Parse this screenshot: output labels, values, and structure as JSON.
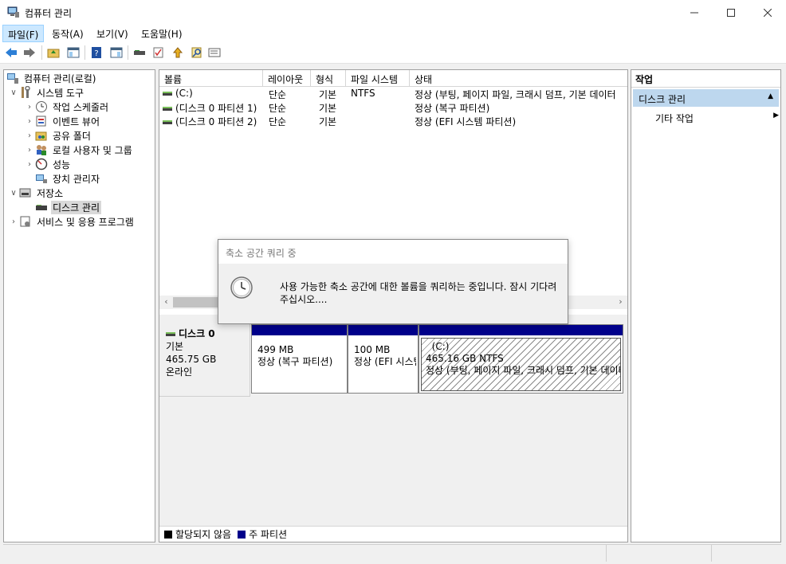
{
  "window": {
    "title": "컴퓨터 관리"
  },
  "menu": [
    "파일(F)",
    "동작(A)",
    "보기(V)",
    "도움말(H)"
  ],
  "tree": {
    "root": "컴퓨터 관리(로컬)",
    "items": [
      {
        "label": "시스템 도구",
        "icon": "tools-icon"
      },
      {
        "label": "작업 스케줄러",
        "icon": "clock-icon"
      },
      {
        "label": "이벤트 뷰어",
        "icon": "event-viewer-icon"
      },
      {
        "label": "공유 폴더",
        "icon": "shared-folder-icon"
      },
      {
        "label": "로컬 사용자 및 그룹",
        "icon": "users-icon"
      },
      {
        "label": "성능",
        "icon": "performance-icon"
      },
      {
        "label": "장치 관리자",
        "icon": "device-manager-icon"
      },
      {
        "label": "저장소",
        "icon": "storage-icon"
      },
      {
        "label": "디스크 관리",
        "icon": "disk-icon"
      },
      {
        "label": "서비스 및 응용 프로그램",
        "icon": "services-icon"
      }
    ]
  },
  "volume_list": {
    "columns": [
      "볼륨",
      "레이아웃",
      "형식",
      "파일 시스템",
      "상태"
    ],
    "rows": [
      {
        "volume": "(C:)",
        "layout": "단순",
        "type": "기본",
        "fs": "NTFS",
        "status": "정상 (부팅, 페이지 파일, 크래시 덤프, 기본 데이터"
      },
      {
        "volume": "(디스크 0 파티션 1)",
        "layout": "단순",
        "type": "기본",
        "fs": "",
        "status": "정상 (복구 파티션)"
      },
      {
        "volume": "(디스크 0 파티션 2)",
        "layout": "단순",
        "type": "기본",
        "fs": "",
        "status": "정상 (EFI 시스템 파티션)"
      }
    ]
  },
  "disk": {
    "name": "디스크 0",
    "type": "기본",
    "size": "465.75 GB",
    "state": "온라인",
    "partitions": [
      {
        "title": "",
        "size": "499 MB",
        "status": "정상 (복구 파티션)"
      },
      {
        "title": "",
        "size": "100 MB",
        "status": "정상 (EFI 시스템 파티션)"
      },
      {
        "title": "(C:)",
        "size": "465.16 GB NTFS",
        "status": "정상 (부팅, 페이지 파일, 크래시 덤프, 기본 데이터 파티션)"
      }
    ]
  },
  "legend": [
    {
      "label": "할당되지 않음",
      "color": "#000000"
    },
    {
      "label": "주 파티션",
      "color": "#00008b"
    }
  ],
  "actions": {
    "title": "작업",
    "group": "디스크 관리",
    "item": "기타 작업"
  },
  "dialog": {
    "title": "축소 공간 쿼리 중",
    "message": "사용 가능한 축소 공간에 대한 볼륨을 쿼리하는 중입니다. 잠시 기다려 주십시오...."
  }
}
